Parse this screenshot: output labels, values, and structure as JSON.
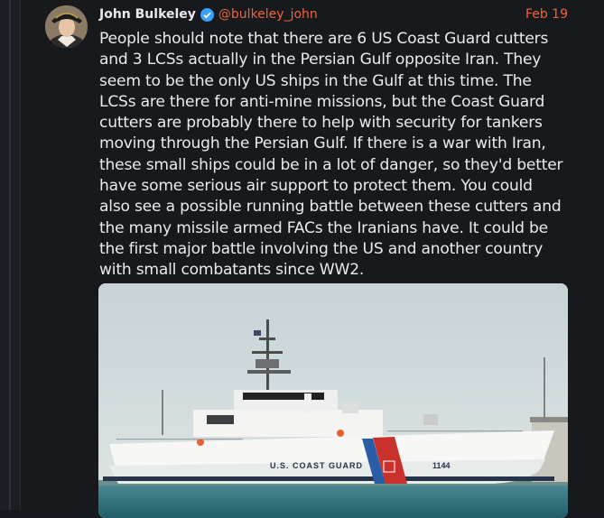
{
  "author": {
    "name": "John Bulkeley",
    "handle": "@bulkeley_john",
    "verified_icon": "verified-check-icon"
  },
  "post": {
    "date": "Feb 19",
    "text": "People should note that there are 6 US Coast Guard cutters\nand 3 LCSs actually in the Persian Gulf opposite Iran. They\nseem to be the only US ships in the Gulf at this time. The\nLCSs are there for anti-mine missions, but the Coast Guard\ncutters are probably there to help with security for tankers\nmoving through the Persian Gulf. If there is a war with Iran,\nthese small ships could be in a lot of danger, so they'd better\nhave some serious air support to protect them. You could\nalso see a possible running battle between these cutters and\nthe many missile armed FACs the Iranians have. It could be\nthe first major battle involving the US and another country\nwith small combatants since WW2.",
    "image": {
      "hull_text": "U.S. COAST GUARD",
      "hull_number": "1144"
    }
  },
  "colors": {
    "accent": "#f0623a",
    "verified": "#3aa0ff",
    "background": "#17191c"
  }
}
